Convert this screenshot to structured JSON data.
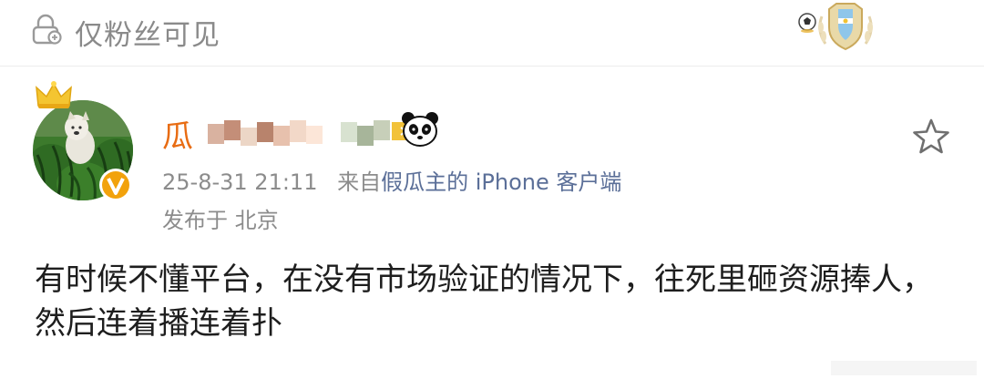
{
  "topbar": {
    "visibility_label": "仅粉丝可见"
  },
  "icons": {
    "lock": "lock-icon",
    "badge": "argentina-shield-badge-icon",
    "football": "football-icon",
    "crown": "crown-icon",
    "verified": "verified-v-icon",
    "panda": "panda-icon",
    "star": "star-icon"
  },
  "post": {
    "username_visible": "瓜",
    "timestamp": "25-8-31 21:11",
    "from_prefix": "来自",
    "source": "假瓜主的 iPhone 客户端",
    "location": "发布于 北京",
    "content": "有时候不懂平台，在没有市场验证的情况下，往死里砸资源捧人，然后连着播连着扑"
  },
  "colors": {
    "username": "#e86c13",
    "source_link": "#5b6f98",
    "meta_text": "#8c8c8c",
    "body_text": "#1e1e1e",
    "verified_badge": "#f2a20c"
  }
}
